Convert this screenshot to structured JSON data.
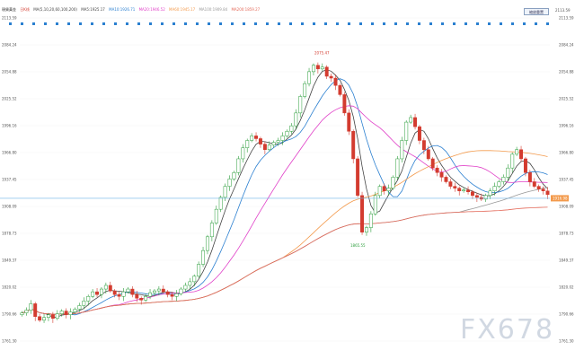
{
  "toolbar": {
    "title": "現貨黃金",
    "period": "日K线",
    "ma_params": "MA(5,10,20,60,100,200)",
    "ma5": "MA5:1925.17",
    "ma10": "MA10:1926.71",
    "ma20": "MA20:1946.52",
    "ma60": "MA60:1945.17",
    "ma100": "MA100:1909.84",
    "ma200": "MA200:1859.27",
    "reset_label": "縮放重置",
    "top_price": "2113.59"
  },
  "colors": {
    "ma5": "#444444",
    "ma10": "#2a7fd0",
    "ma20": "#e040c8",
    "ma60": "#f39a4c",
    "ma100": "#999999",
    "ma200": "#e46a5a",
    "up": "#2a9d3a",
    "down": "#d33b2f",
    "current_line": "#6fb4e6"
  },
  "watermark": "FX678",
  "chart_data": {
    "type": "line",
    "y_ticks": [
      "2113.59",
      "2084.24",
      "2054.88",
      "2025.52",
      "1996.16",
      "1966.80",
      "1937.45",
      "1908.09",
      "1878.73",
      "1849.37",
      "1820.02",
      "1790.66",
      "1761.30"
    ],
    "ylim": [
      1761.3,
      2113.59
    ],
    "annotations": [
      {
        "label": "2075.47",
        "value": 2075.47
      },
      {
        "label": "1865.55",
        "value": 1865.55
      },
      {
        "label": "1737.71",
        "value": 1737.71
      }
    ],
    "current_price": "1916.98",
    "current_value": 1916.98,
    "close": [
      1792,
      1795,
      1802,
      1788,
      1784,
      1787,
      1790,
      1786,
      1791,
      1794,
      1790,
      1793,
      1796,
      1800,
      1805,
      1810,
      1815,
      1812,
      1818,
      1822,
      1816,
      1812,
      1810,
      1815,
      1818,
      1812,
      1808,
      1806,
      1810,
      1814,
      1816,
      1818,
      1815,
      1812,
      1810,
      1813,
      1818,
      1822,
      1826,
      1832,
      1845,
      1860,
      1875,
      1890,
      1905,
      1918,
      1930,
      1938,
      1945,
      1960,
      1972,
      1980,
      1985,
      1982,
      1976,
      1970,
      1975,
      1978,
      1980,
      1985,
      1990,
      1996,
      2010,
      2028,
      2042,
      2055,
      2062,
      2058,
      2060,
      2050,
      2048,
      2040,
      2030,
      2010,
      1990,
      1960,
      1920,
      1880,
      1885,
      1900,
      1920,
      1930,
      1925,
      1928,
      1940,
      1960,
      1980,
      2000,
      2005,
      1995,
      1980,
      1970,
      1960,
      1950,
      1945,
      1940,
      1935,
      1930,
      1928,
      1925,
      1926,
      1924,
      1920,
      1918,
      1916,
      1920,
      1925,
      1930,
      1935,
      1940,
      1950,
      1965,
      1970,
      1960,
      1945,
      1935,
      1930,
      1927,
      1925,
      1921
    ]
  }
}
